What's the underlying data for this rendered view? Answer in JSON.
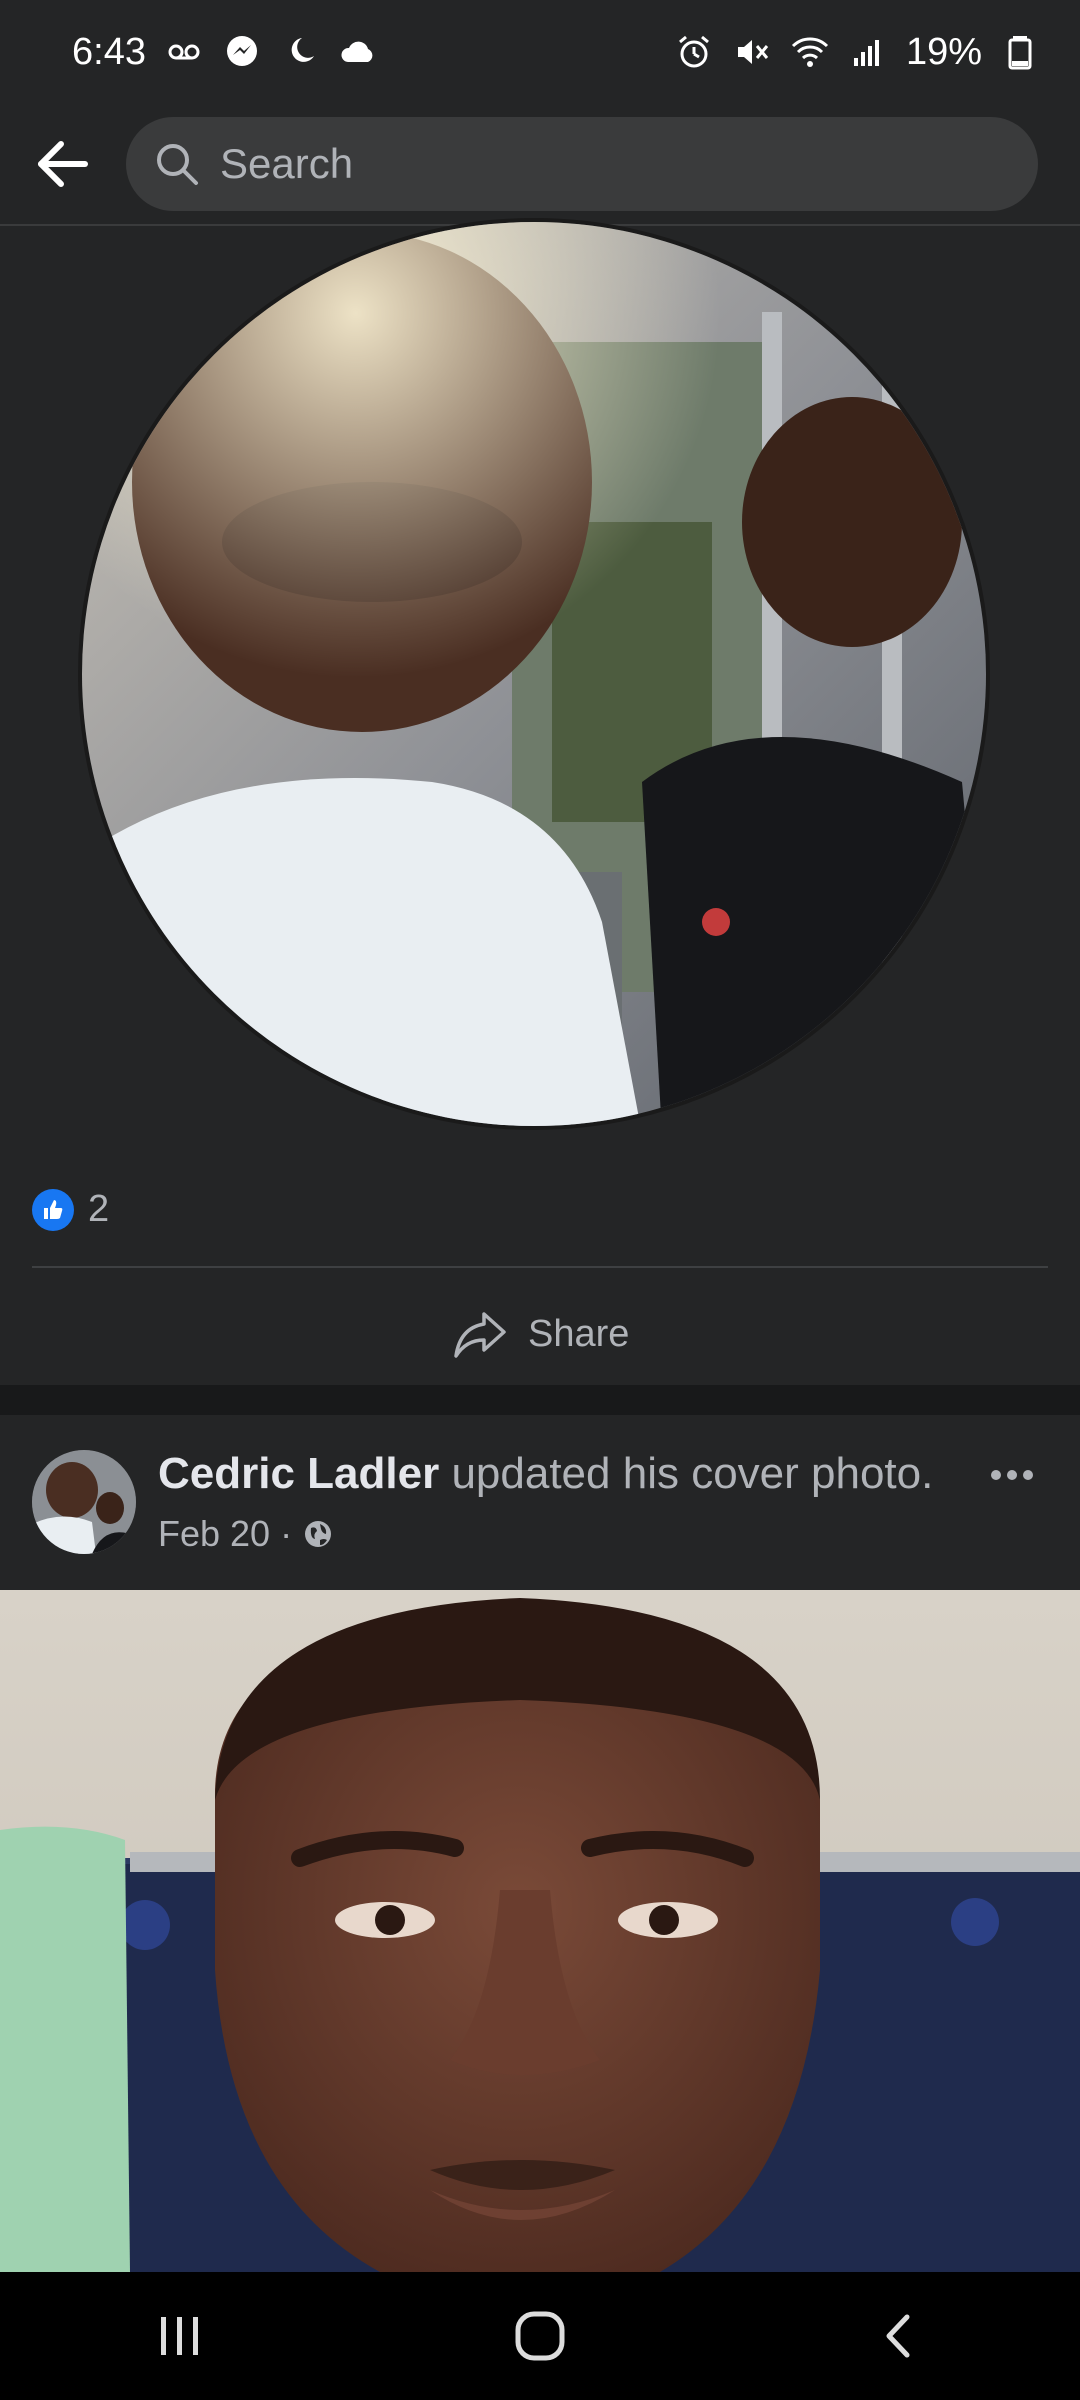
{
  "status_bar": {
    "time": "6:43",
    "battery": "19%",
    "left_icons": [
      "voicemail-icon",
      "messenger-icon",
      "sleep-icon",
      "cloud-icon"
    ],
    "right_icons": [
      "alarm-icon",
      "mute-icon",
      "wifi-icon",
      "signal-icon",
      "battery-icon"
    ]
  },
  "top_bar": {
    "search_placeholder": "Search"
  },
  "post1": {
    "reaction_count": "2",
    "share_label": "Share"
  },
  "post2": {
    "author": "Cedric Ladler",
    "action": " updated his cover photo.",
    "date": "Feb 20",
    "separator": " · ",
    "privacy_icon": "globe-icon"
  },
  "colors": {
    "background": "#242526",
    "separator_band": "#18191a",
    "like_blue": "#1877f2",
    "secondary_text": "#b0b3b8",
    "primary_text": "#e4e6eb"
  }
}
